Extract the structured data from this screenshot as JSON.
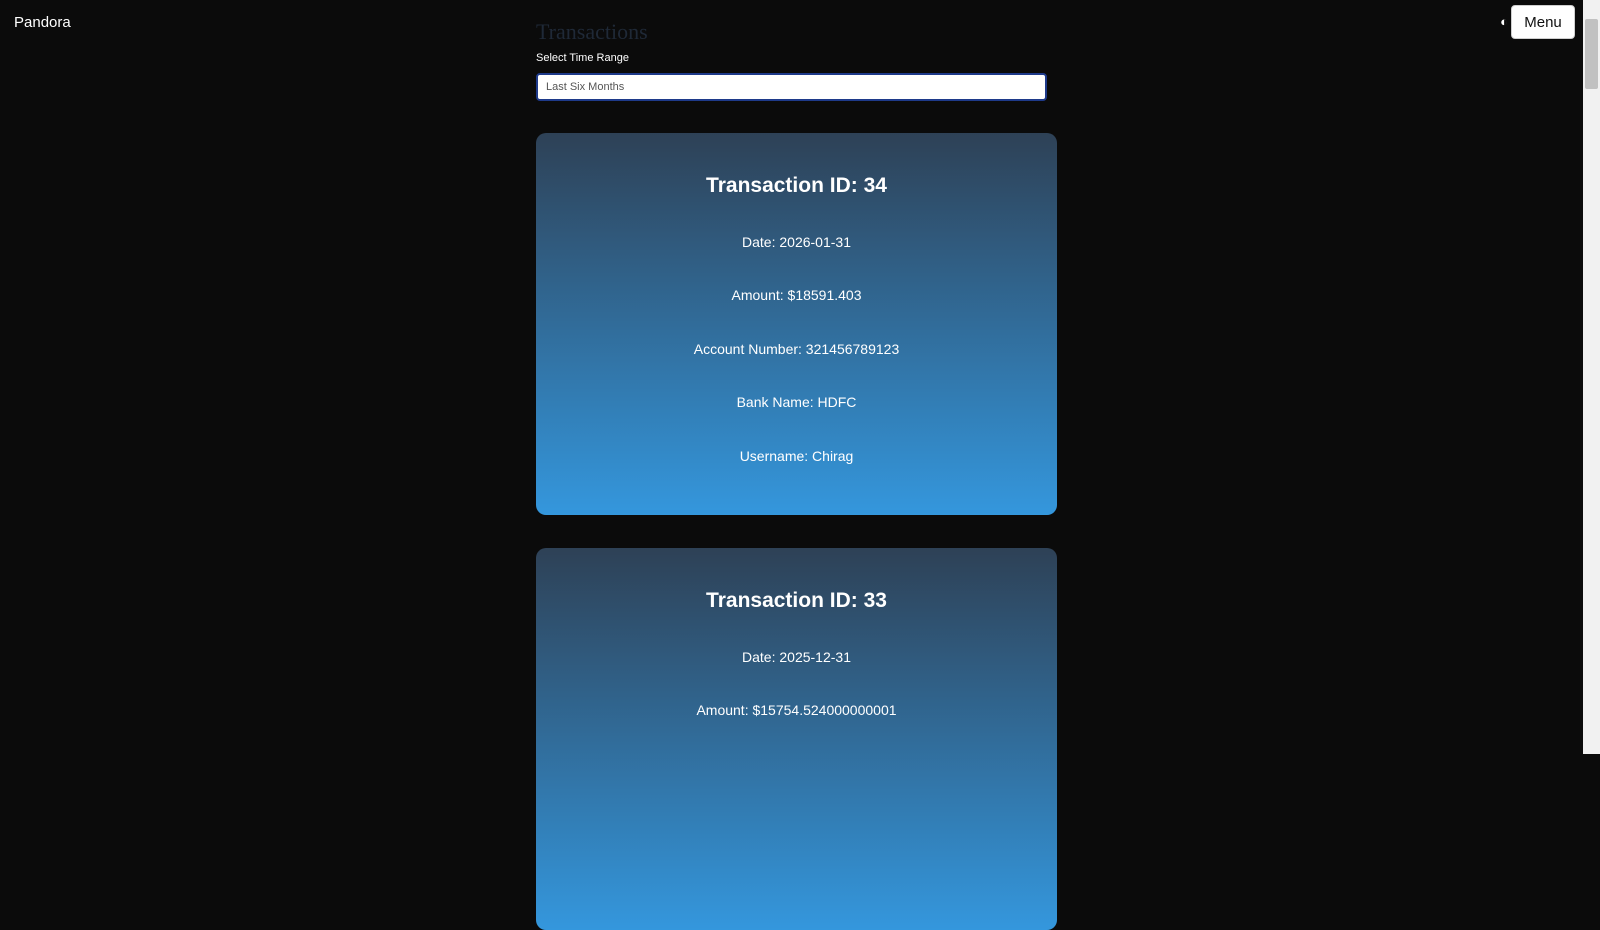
{
  "header": {
    "brand": "Pandora",
    "theme_toggle_glyph": "◐",
    "menu_label": "Menu"
  },
  "filters": {
    "title": "Transactions",
    "time_range_label": "Select Time Range",
    "time_range_value": "Last Six Months"
  },
  "transactions": [
    {
      "heading": "Transaction ID: 34",
      "date": "Date: 2026-01-31",
      "amount": "Amount: $18591.403",
      "account": "Account Number: 321456789123",
      "bank": "Bank Name: HDFC",
      "username": "Username: Chirag"
    },
    {
      "heading": "Transaction ID: 33",
      "date": "Date: 2025-12-31",
      "amount": "Amount: $15754.524000000001"
    }
  ],
  "colors": {
    "background": "#0b0b0b",
    "card_gradient_top": "#2e4156",
    "card_gradient_bottom": "#3497dd",
    "input_border": "#1e3a8a"
  }
}
